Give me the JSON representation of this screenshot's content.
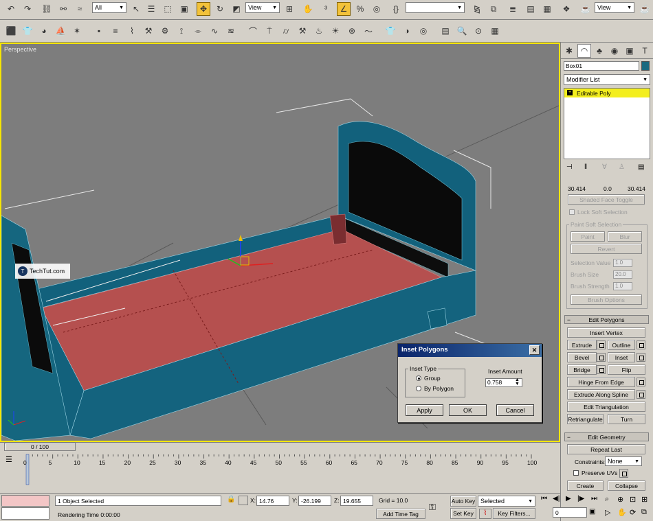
{
  "toolbar": {
    "selection_filter": "All",
    "ref_coord": "View",
    "named_sel": "",
    "view_dropdown": "View"
  },
  "viewport": {
    "label": "Perspective",
    "watermark": "TechTut.com",
    "frame_counter": "0 / 100"
  },
  "panel": {
    "object_name": "Box01",
    "modifier_list": "Modifier List",
    "stack_item": "Editable Poly",
    "soft_values": [
      "30.414",
      "0.0",
      "30.414"
    ],
    "shaded_face_toggle": "Shaded Face Toggle",
    "lock_soft_selection": "Lock Soft Selection",
    "paint_soft_selection": "Paint Soft Selection",
    "paint": "Paint",
    "blur": "Blur",
    "revert": "Revert",
    "selection_value_label": "Selection Value",
    "selection_value": "1.0",
    "brush_size_label": "Brush Size",
    "brush_size": "20.0",
    "brush_strength_label": "Brush Strength",
    "brush_strength": "1.0",
    "brush_options": "Brush Options",
    "edit_polygons": "Edit Polygons",
    "insert_vertex": "Insert Vertex",
    "extrude": "Extrude",
    "outline": "Outline",
    "bevel": "Bevel",
    "inset": "Inset",
    "bridge": "Bridge",
    "flip": "Flip",
    "hinge_from_edge": "Hinge From Edge",
    "extrude_along_spline": "Extrude Along Spline",
    "edit_triangulation": "Edit Triangulation",
    "retriangulate": "Retriangulate",
    "turn": "Turn",
    "edit_geometry": "Edit Geometry",
    "repeat_last": "Repeat Last",
    "constraints_label": "Constraints:",
    "constraints_value": "None",
    "preserve_uvs": "Preserve UVs",
    "create": "Create",
    "collapse": "Collapse"
  },
  "dialog": {
    "title": "Inset Polygons",
    "inset_type": "Inset Type",
    "group": "Group",
    "by_polygon": "By Polygon",
    "inset_amount_label": "Inset Amount",
    "inset_amount": "0.758",
    "apply": "Apply",
    "ok": "OK",
    "cancel": "Cancel"
  },
  "timeline": {
    "ticks": [
      "0",
      "5",
      "10",
      "15",
      "20",
      "25",
      "30",
      "35",
      "40",
      "45",
      "50",
      "55",
      "60",
      "65",
      "70",
      "75",
      "80",
      "85",
      "90",
      "95",
      "100"
    ]
  },
  "status": {
    "objects_selected": "1 Object Selected",
    "rendering_time": "Rendering Time  0:00:00",
    "x_label": "X:",
    "x_value": "14.76",
    "y_label": "Y:",
    "y_value": "-26.199",
    "z_label": "Z:",
    "z_value": "19.655",
    "grid": "Grid = 10.0",
    "add_time_tag": "Add Time Tag",
    "auto_key": "Auto Key",
    "set_key": "Set Key",
    "selected": "Selected",
    "key_filters": "Key Filters...",
    "frame_value": "0"
  },
  "colors": {
    "viewport_bg": "#7d7d7d",
    "active_border": "#f7e600",
    "bed_frame": "#1f6f8b",
    "selected_face": "#b5504f"
  }
}
